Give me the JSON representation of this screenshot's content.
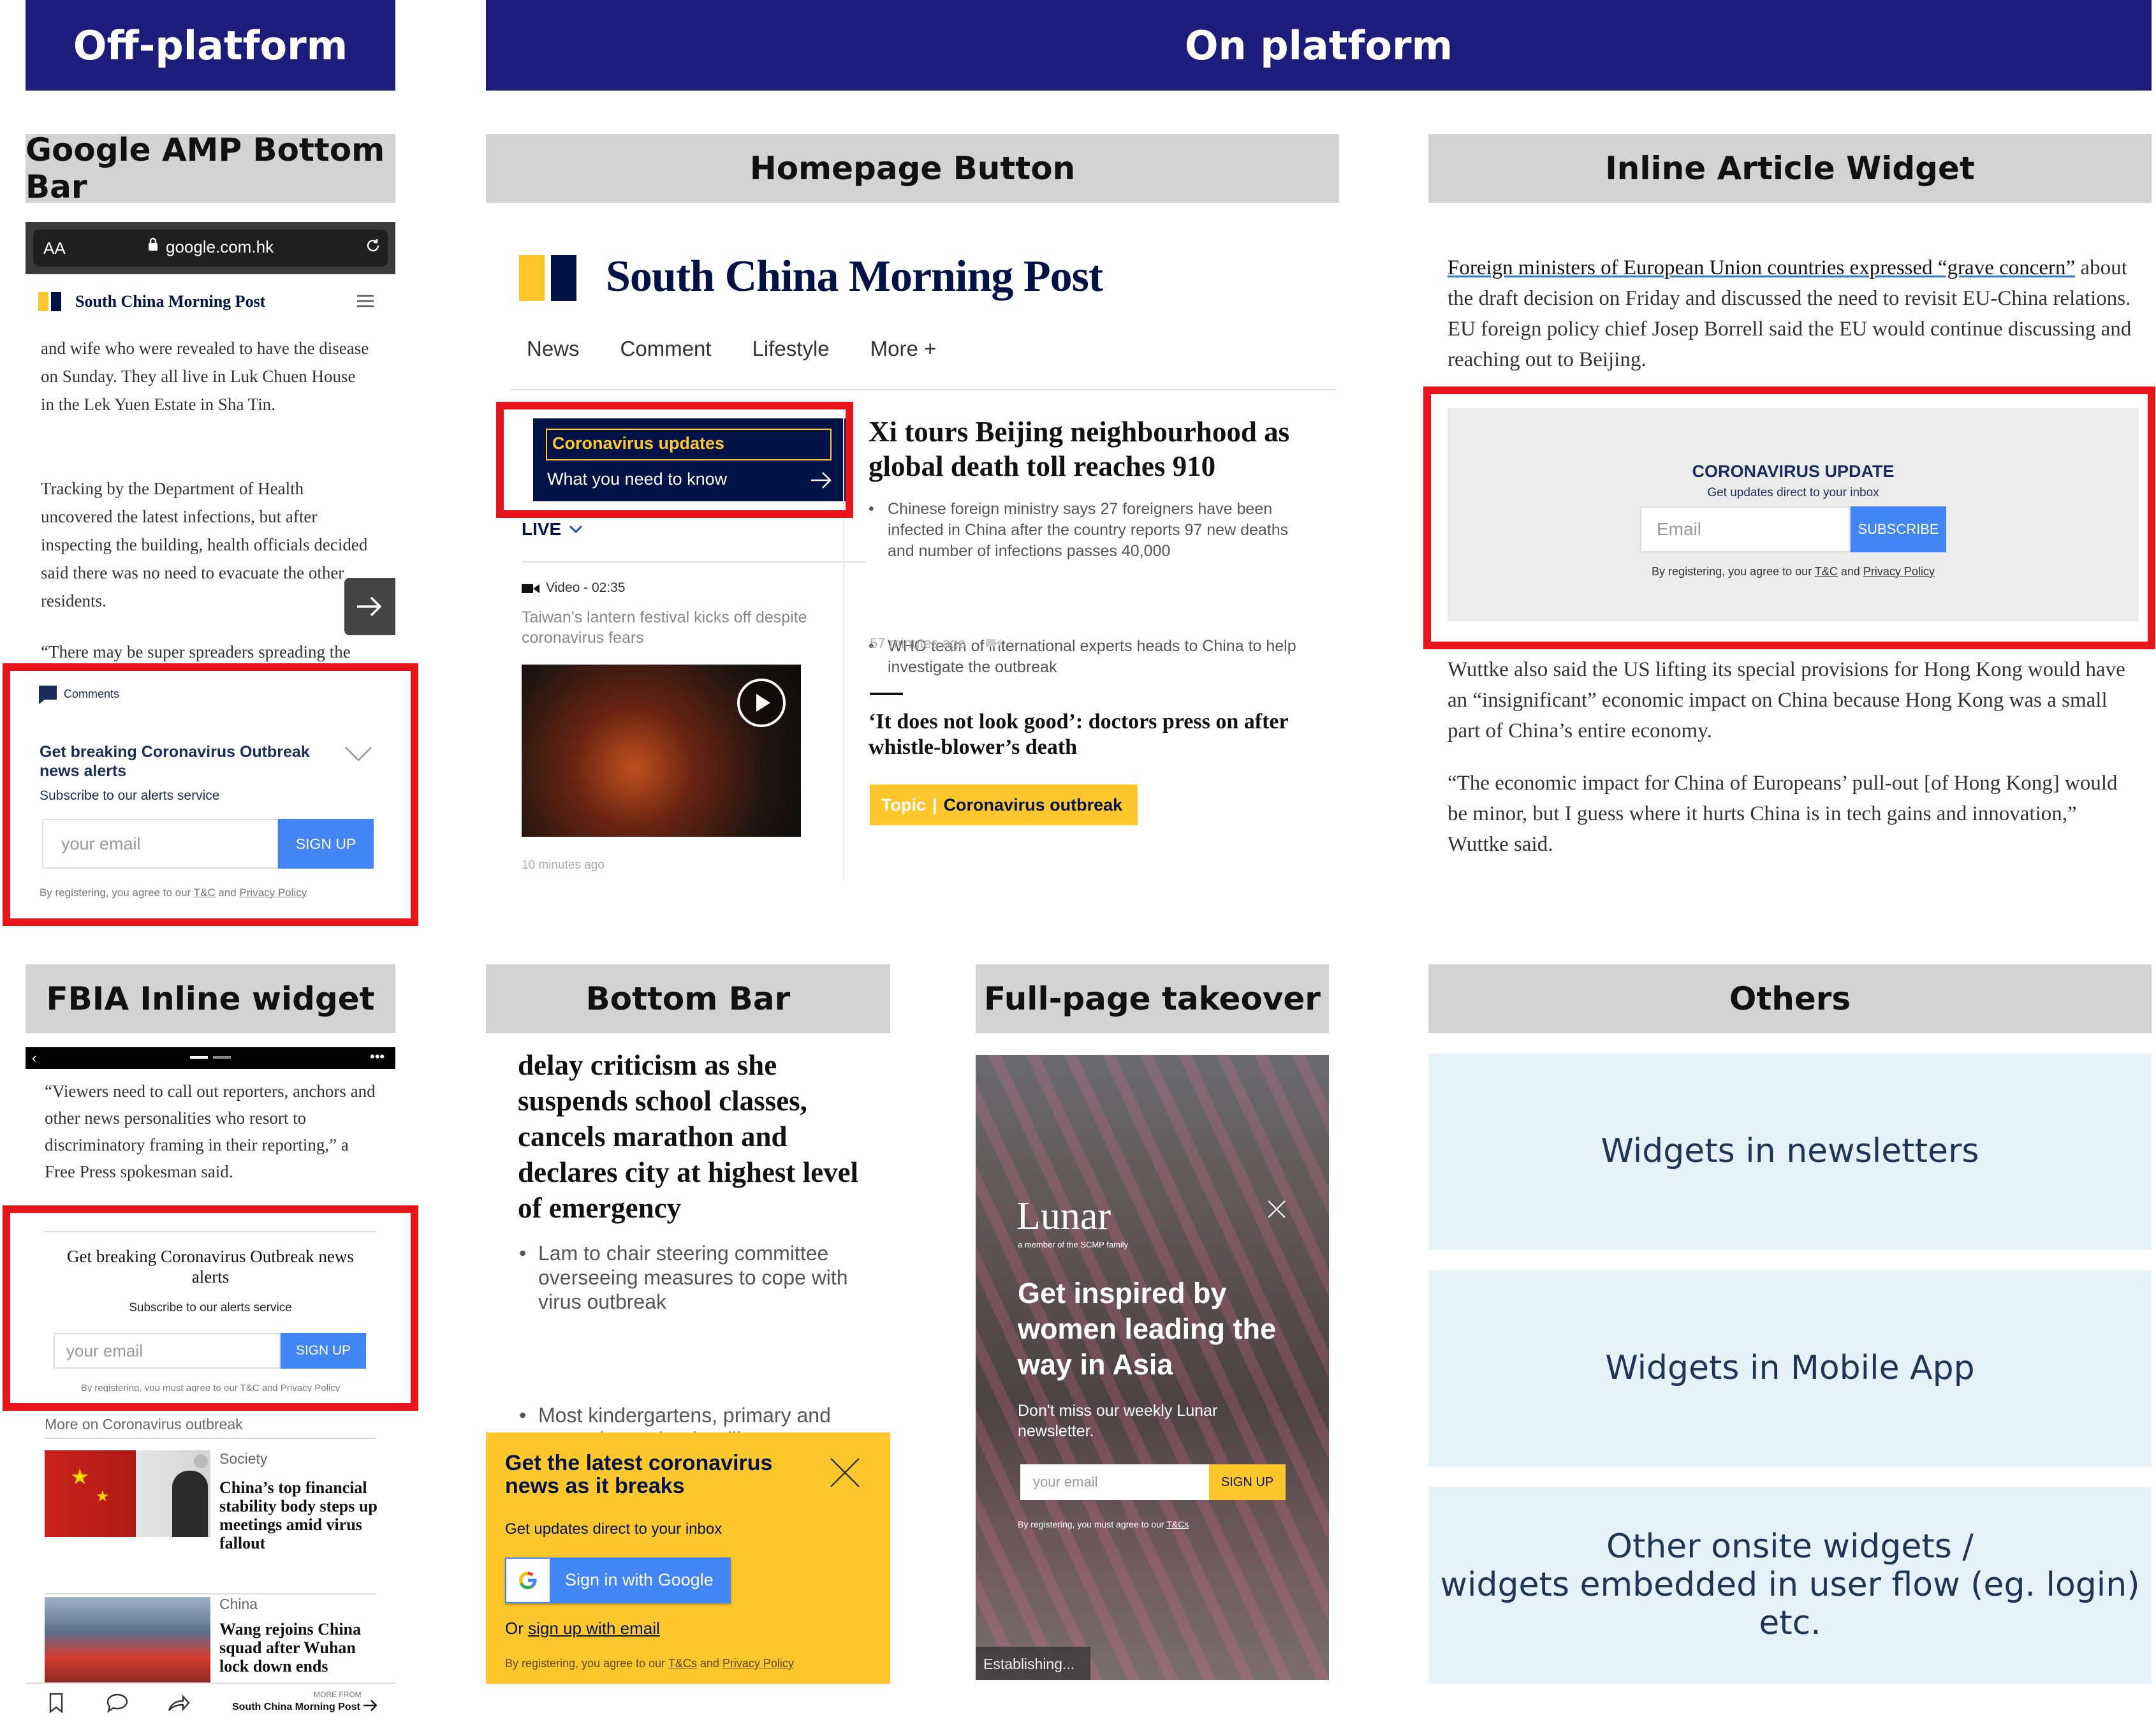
{
  "headers": {
    "off_platform": "Off-platform",
    "on_platform": "On platform"
  },
  "sections": {
    "amp": "Google AMP Bottom Bar",
    "homepage": "Homepage Button",
    "inline": "Inline Article Widget",
    "fbia": "FBIA Inline widget",
    "bottombar": "Bottom Bar",
    "takeover": "Full-page takeover",
    "others": "Others"
  },
  "amp": {
    "aa": "AA",
    "url": "google.com.hk",
    "logo": "South China Morning Post",
    "p1": "and wife who were revealed to have the disease on Sunday. They all live in Luk Chuen House in the Lek Yuen Estate in Sha Tin.",
    "p2": "Tracking by the Department of Health uncovered the latest infections, but after inspecting the building, health officials decided said there was no need to evacuate the other residents.",
    "p3": "“There may be super spreaders spreading the virus in the building. Initial",
    "comments": "Comments",
    "widget_title": "Get breaking Coronavirus Outbreak news alerts",
    "widget_sub": "Subscribe to our alerts service",
    "placeholder": "your email",
    "signup": "SIGN UP",
    "legal_pre": "By registering, you agree to our ",
    "tc": "T&C",
    "and": " and ",
    "privacy": "Privacy Policy"
  },
  "homepage": {
    "logo": "South China Morning Post",
    "nav": [
      "News",
      "Comment",
      "Lifestyle",
      "More +"
    ],
    "btn_title": "Coronavirus updates",
    "btn_sub": "What you need to know",
    "live": "LIVE",
    "video_label": "Video - 02:35",
    "video_caption": "Taiwan's lantern festival kicks off despite coronavirus fears",
    "time_small": "10 minutes ago",
    "headline": "Xi tours Beijing neighbourhood as global death toll reaches 910",
    "bullet1": "Chinese foreign ministry says 27 foreigners have been infected in China after the country reports 97 new deaths and number of infections passes 40,000",
    "bullet2": "WHO team of international experts heads to China to help investigate the outbreak",
    "time": "57 minutes ago",
    "headline2": "‘It does not look good’: doctors press on after whistle-blower’s death",
    "topic": "Topic",
    "topic_name": "Coronavirus outbreak"
  },
  "inline": {
    "p1_link": "Foreign ministers of European Union countries expressed “grave concern”",
    "p1_rest": " about the draft decision on Friday and discussed the need to revisit EU-China relations. EU foreign policy chief Josep Borrell said the EU would continue discussing and reaching out to Beijing.",
    "widget_title": "CORONAVIRUS UPDATE",
    "widget_sub": "Get updates direct to your inbox",
    "placeholder": "Email",
    "subscribe": "SUBSCRIBE",
    "legal_pre": "By registering, you agree to our ",
    "tc": "T&C",
    "and": " and ",
    "privacy": "Privacy Policy",
    "p2": "Wuttke also said the US lifting its special provisions for Hong Kong would have an “insignificant” economic impact on China because Hong Kong was a small part of China’s entire economy.",
    "p3": "“The economic impact for China of Europeans’ pull-out [of Hong Kong] would be minor, but I guess where it hurts China is in tech gains and innovation,” Wuttke said."
  },
  "fbia": {
    "quote": "“Viewers need to call out reporters, anchors and other news personalities who resort to discriminatory framing in their reporting,” a Free Press spokesman said.",
    "widget_title": "Get breaking Coronavirus Outbreak news alerts",
    "widget_sub": "Subscribe to our alerts service",
    "placeholder": "your email",
    "signup": "SIGN UP",
    "legal": "By registering, you must agree to our T&C and Privacy Policy",
    "more_on": "More on Coronavirus outbreak",
    "item1_cat": "Society",
    "item1_title": "China’s top financial stability body steps up meetings amid virus fallout",
    "item2_cat": "China",
    "item2_title": "Wang rejoins China squad after Wuhan lock down ends",
    "more_from": "MORE FROM",
    "more_from_name": "South China Morning Post"
  },
  "bottombar": {
    "headline": "delay criticism as she suspends school classes, cancels marathon and declares city at highest level of emergency",
    "bullet1": "Lam to chair steering committee overseeing measures to cope with virus outbreak",
    "bullet2": "Most kindergartens, primary and secondary schools will not reopen until February 17 while Standard Chartered Hong Kong Marathon",
    "bar_title": "Get the latest coronavirus news as it breaks",
    "bar_sub": "Get updates direct to your inbox",
    "google": "Sign in with Google",
    "or": "Or ",
    "email_link": "sign up with email",
    "legal_pre": "By registering, you agree to our ",
    "tc": "T&Cs",
    "and": " and ",
    "privacy": "Privacy Policy"
  },
  "takeover": {
    "brand": "Lunar",
    "brand_sub": "a member of the SCMP family",
    "title": "Get inspired by women leading the way in Asia",
    "desc": "Don't miss our weekly Lunar newsletter.",
    "placeholder": "your email",
    "signup": "SIGN UP",
    "legal_pre": "By registering, you must agree to our ",
    "tc": "T&Cs",
    "status": "Establishing..."
  },
  "others": {
    "newsletters": "Widgets in newsletters",
    "mobile": "Widgets in Mobile App",
    "onsite_l1": "Other onsite widgets /",
    "onsite_l2": "widgets embedded in user flow (eg. login) etc."
  },
  "colors": {
    "navy": "#1c1c7d",
    "header_gray": "#d3d3d3",
    "highlight_red": "#e8141b",
    "cta_blue": "#4285f4",
    "scmp_yellow": "#ffc72c",
    "others_bg": "#e6f2fa"
  }
}
